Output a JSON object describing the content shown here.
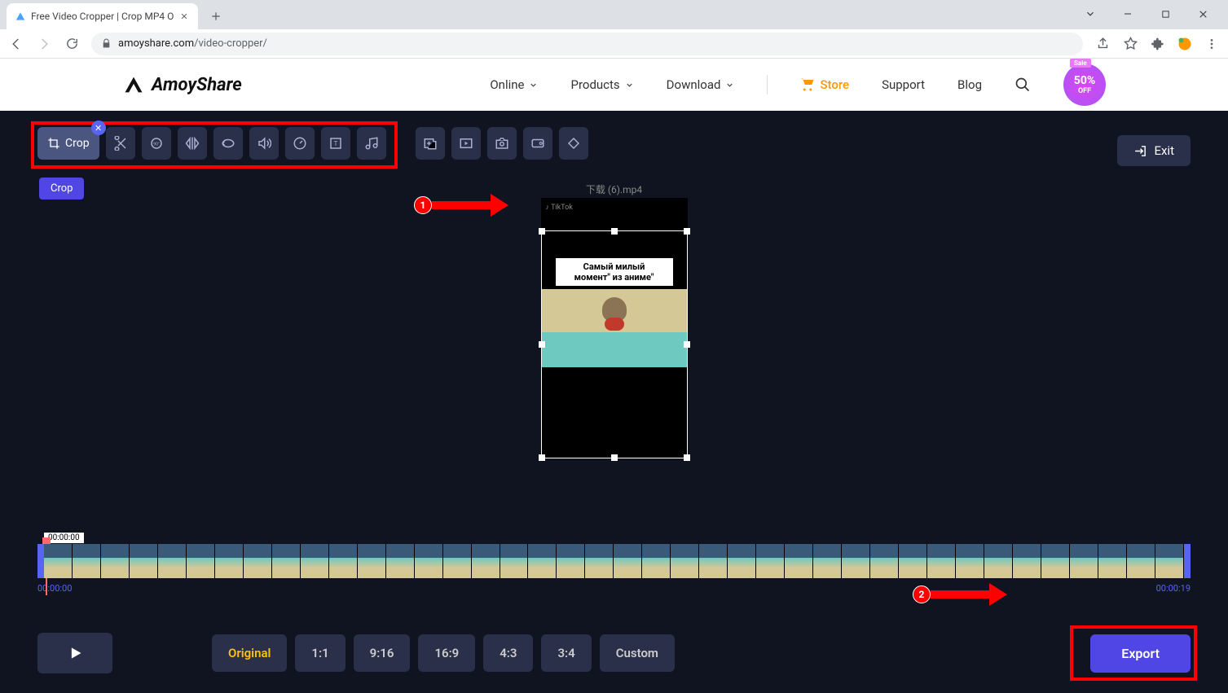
{
  "browser": {
    "tab_title": "Free Video Cropper | Crop MP4 O",
    "url_domain": "amoyshare.com",
    "url_path": "/video-cropper/"
  },
  "header": {
    "logo": "AmoyShare",
    "nav": {
      "online": "Online",
      "products": "Products",
      "download": "Download",
      "store": "Store",
      "support": "Support",
      "blog": "Blog"
    },
    "sale": {
      "ribbon": "Sale",
      "pct": "50%",
      "off": "OFF"
    }
  },
  "editor": {
    "crop_label": "Crop",
    "crop_tooltip": "Crop",
    "exit_label": "Exit",
    "filename": "下载 (6).mp4",
    "video_watermark": "TikTok",
    "video_caption_l1": "Самый милый",
    "video_caption_l2": "момент\" из аниме\"",
    "time_indicator": "00:00:00",
    "time_start": "00:00:00",
    "time_end": "00:00:19",
    "ratios": {
      "original": "Original",
      "r11": "1:1",
      "r916": "9:16",
      "r169": "16:9",
      "r43": "4:3",
      "r34": "3:4",
      "custom": "Custom"
    },
    "export_label": "Export"
  },
  "annotations": {
    "one": "1",
    "two": "2"
  }
}
